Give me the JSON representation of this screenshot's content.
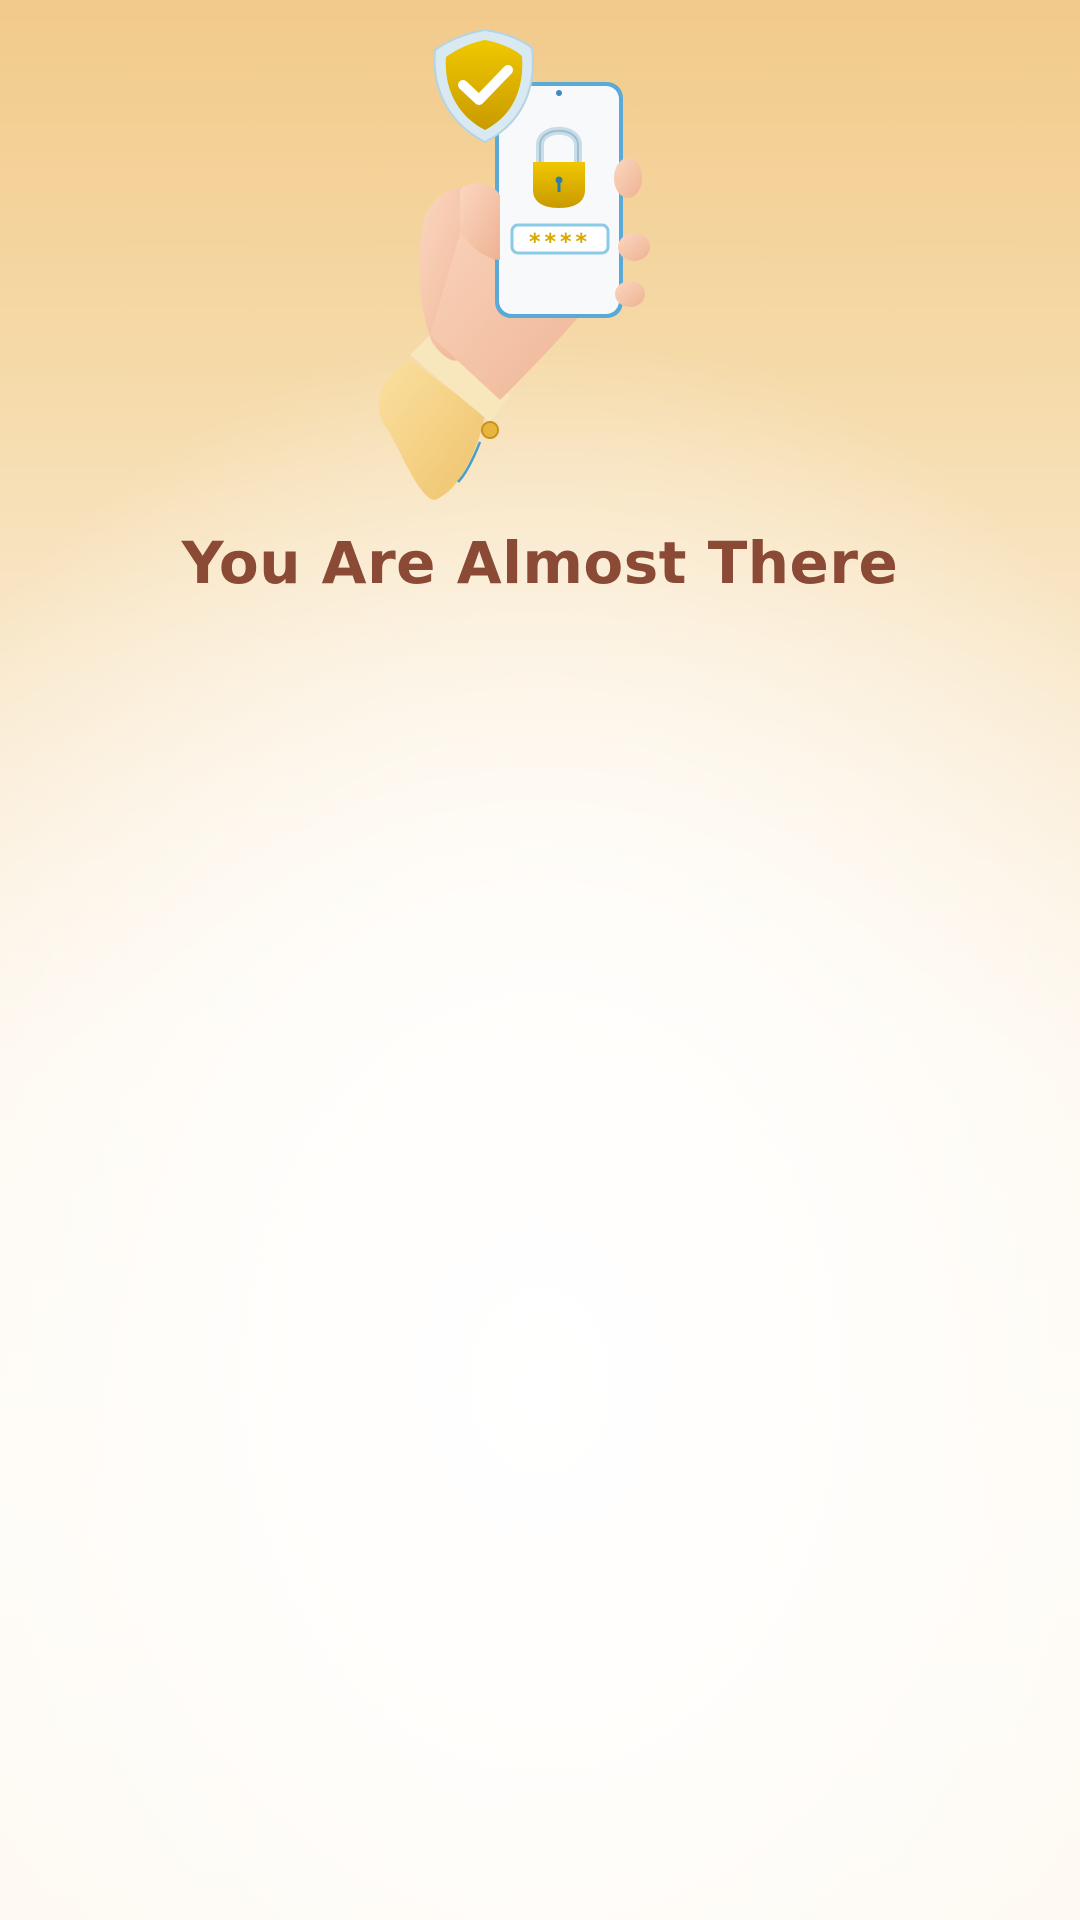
{
  "screen": {
    "title": "You Are Almost There"
  },
  "hero": {
    "icon": "hand-holding-phone-with-lock-and-shield-icon",
    "password_mask": "****"
  },
  "colors": {
    "title": "#8b4a35",
    "background_top": "#f2ca8b",
    "background_bottom": "#fefaf4",
    "accent_yellow": "#e0b400",
    "phone_outline": "#5aaad8"
  }
}
